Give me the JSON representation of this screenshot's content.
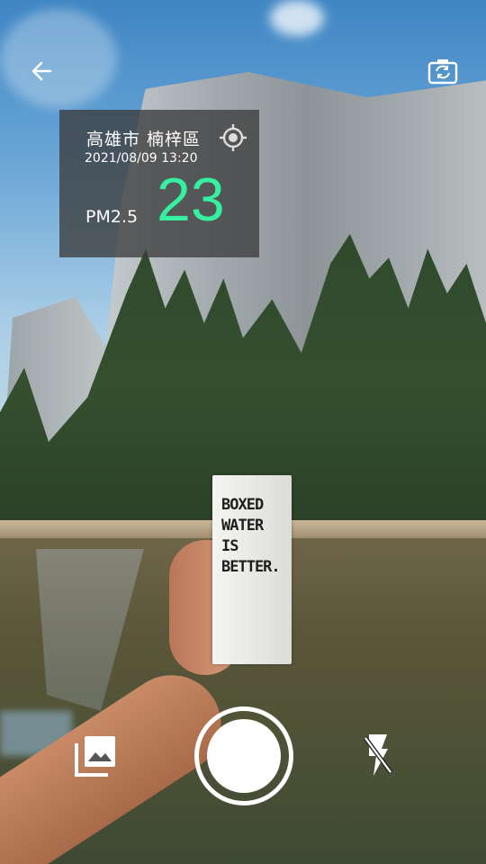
{
  "header": {
    "back_icon": "arrow-left-icon",
    "switch_camera_icon": "camera-switch-icon"
  },
  "info_panel": {
    "location": "高雄市 楠梓區",
    "locate_icon": "crosshair-location-icon",
    "datetime": "2021/08/09 13:20",
    "metric_label": "PM2.5",
    "metric_value": "23",
    "metric_color": "#34f0a0"
  },
  "photo": {
    "carton_lines": [
      "BOXED",
      "WATER",
      "IS",
      "BETTER."
    ]
  },
  "controls": {
    "gallery_icon": "gallery-icon",
    "shutter": "shutter-button",
    "flash_icon": "flash-off-icon"
  }
}
